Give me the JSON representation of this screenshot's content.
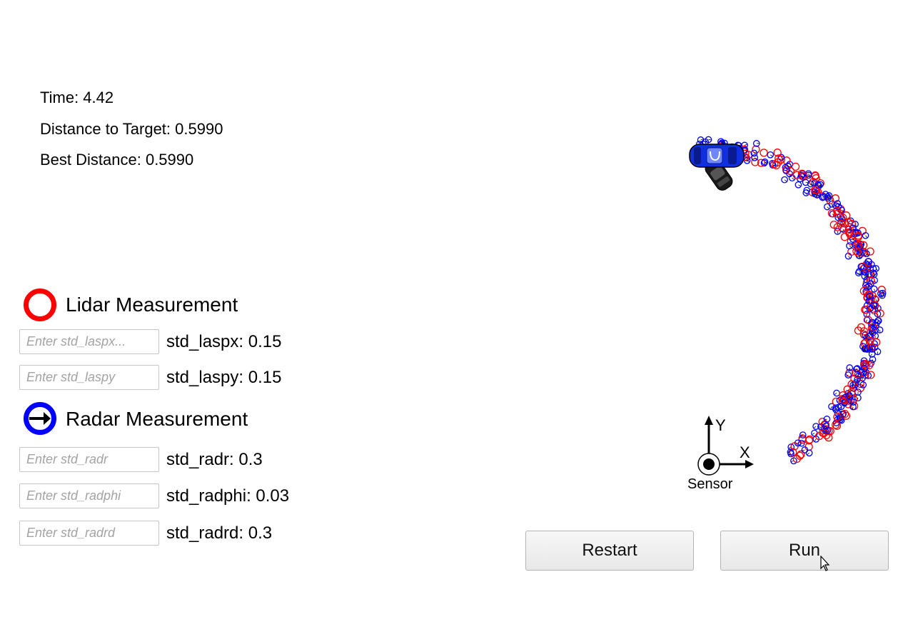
{
  "stats": {
    "time": "Time: 4.42",
    "distance": "Distance to Target: 0.5990",
    "best": "Best Distance: 0.5990"
  },
  "lidar": {
    "title": "Lidar Measurement",
    "color": "#ff0000",
    "px_placeholder": "Enter std_laspx...",
    "px_label": "std_laspx: 0.15",
    "py_placeholder": "Enter std_laspy",
    "py_label": "std_laspy: 0.15"
  },
  "radar": {
    "title": "Radar Measurement",
    "color": "#0000ff",
    "r_placeholder": "Enter std_radr",
    "r_label": "std_radr: 0.3",
    "phi_placeholder": "Enter std_radphi",
    "phi_label": "std_radphi: 0.03",
    "rd_placeholder": "Enter std_radrd",
    "rd_label": "std_radrd: 0.3"
  },
  "axes": {
    "x_label": "X",
    "y_label": "Y",
    "sensor_label": "Sensor"
  },
  "buttons": {
    "restart": "Restart",
    "run": "Run"
  },
  "icons": {
    "lidar": "red-ring-icon",
    "radar": "blue-ring-arrow-icon",
    "cursor": "mouse-pointer-icon",
    "target_car": "blue-car-icon",
    "estimate_car": "black-car-icon",
    "sensor": "sensor-icon"
  }
}
